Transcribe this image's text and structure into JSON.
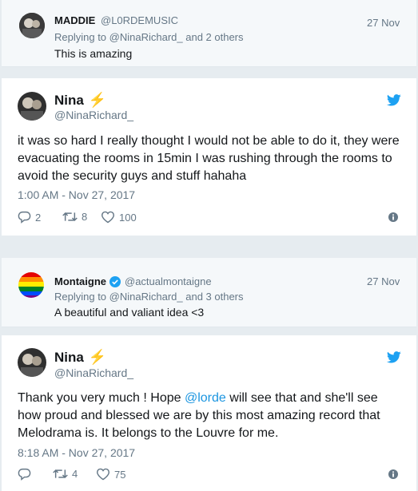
{
  "reply1": {
    "name": "MADDIE",
    "handle": "@L0RDEMUSIC",
    "date": "27 Nov",
    "replying_prefix": "Replying to ",
    "replying_user": "@NinaRichard_",
    "replying_suffix": " and 2 others",
    "text": "This is amazing"
  },
  "tweet1": {
    "name": "Nina",
    "badge": "⚡",
    "handle": "@NinaRichard_",
    "text": "it was so hard I really thought I would not be able to do it, they were evacuating the rooms in 15min I was rushing through the rooms to avoid the security guys and stuff hahaha",
    "timestamp": "1:00 AM - Nov 27, 2017",
    "replies": "2",
    "retweets": "8",
    "likes": "100"
  },
  "reply2": {
    "name": "Montaigne",
    "handle": "@actualmontaigne",
    "date": "27 Nov",
    "replying_prefix": "Replying to ",
    "replying_user": "@NinaRichard_",
    "replying_suffix": " and 3 others",
    "text": "A beautiful and valiant idea <3"
  },
  "tweet2": {
    "name": "Nina",
    "badge": "⚡",
    "handle": "@NinaRichard_",
    "text_before": "Thank you very much ! Hope ",
    "mention": "@lorde",
    "text_after": " will see that and she'll see how proud and blessed we are by this most amazing record that Melodrama is. It belongs to the Louvre for me.",
    "timestamp": "8:18 AM - Nov 27, 2017",
    "replies": "",
    "retweets": "4",
    "likes": "75"
  },
  "colors": {
    "accent": "#1da1f2",
    "muted": "#657786",
    "verified": "#1da1f2"
  }
}
